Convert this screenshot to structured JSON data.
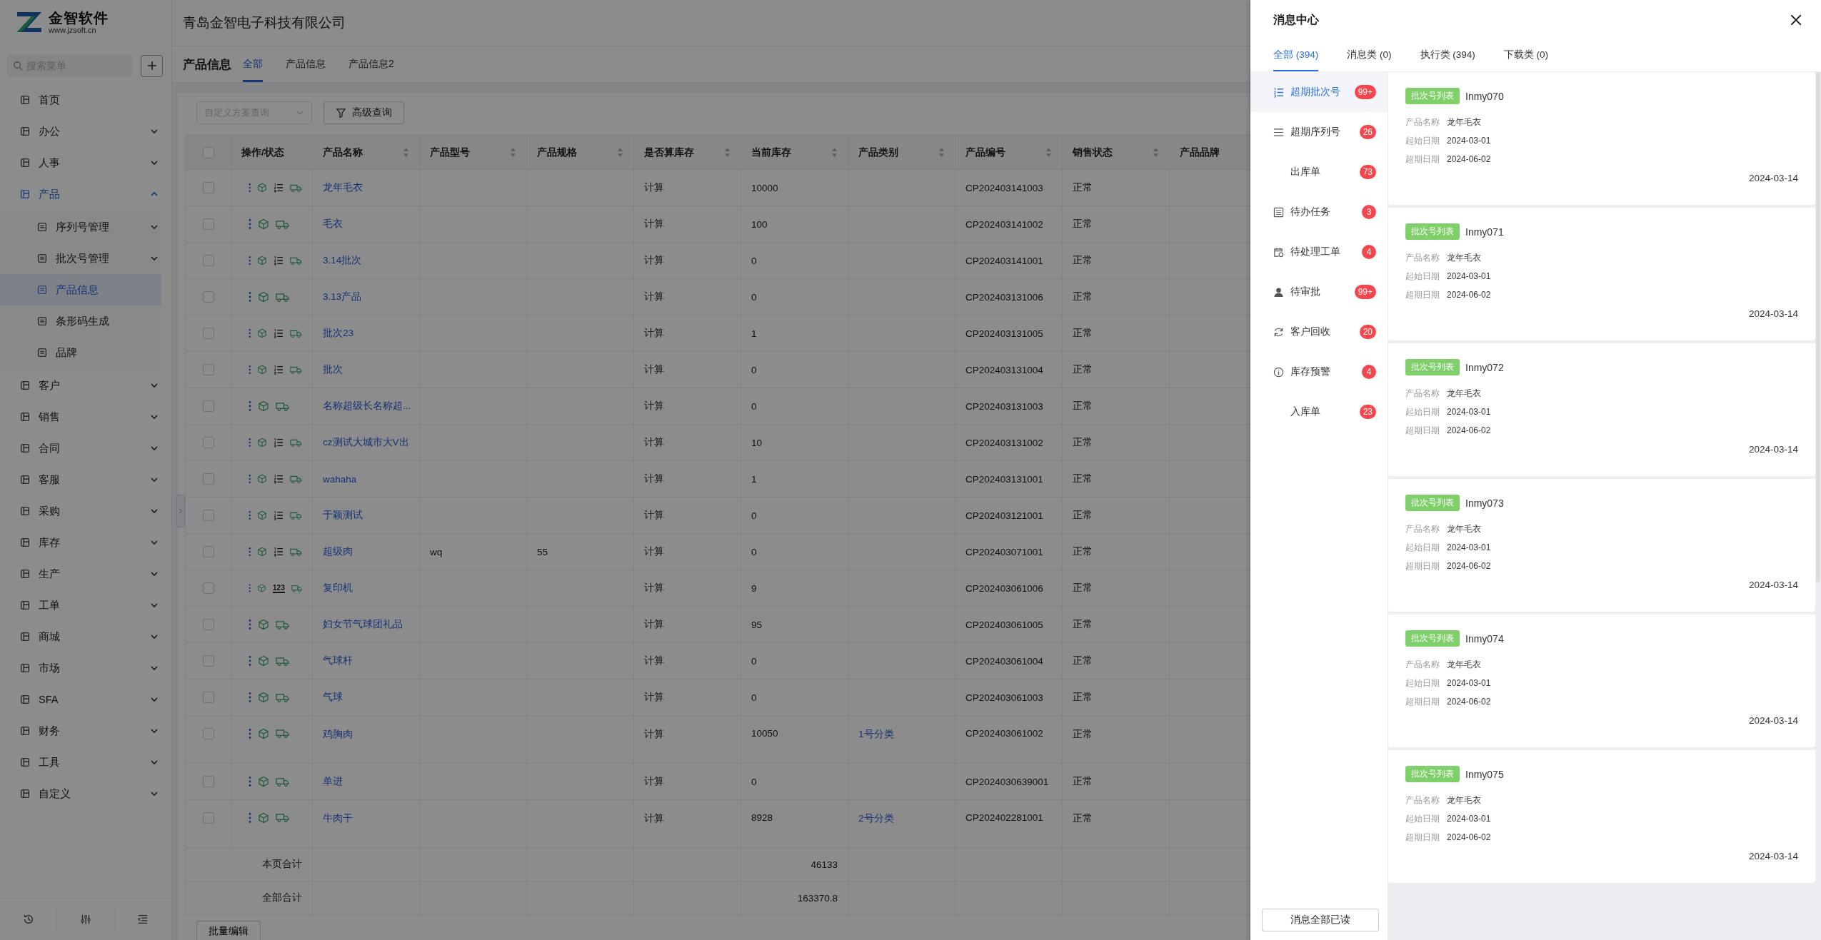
{
  "logo": {
    "name": "金智软件",
    "url": "www.jzsoft.cn"
  },
  "search": {
    "placeholder": "搜索菜单"
  },
  "sidebar": {
    "items": [
      {
        "label": "首页",
        "selected": false
      },
      {
        "label": "办公",
        "selected": false,
        "expanded": false
      },
      {
        "label": "人事",
        "selected": false,
        "expanded": false
      },
      {
        "label": "产品",
        "selected": true,
        "expanded": true,
        "children": [
          {
            "label": "序列号管理",
            "selected": false,
            "expanded": false
          },
          {
            "label": "批次号管理",
            "selected": false,
            "expanded": false
          },
          {
            "label": "产品信息",
            "selected": true
          },
          {
            "label": "条形码生成",
            "selected": false
          },
          {
            "label": "品牌",
            "selected": false
          }
        ]
      },
      {
        "label": "客户",
        "selected": false,
        "expanded": false
      },
      {
        "label": "销售",
        "selected": false,
        "expanded": false
      },
      {
        "label": "合同",
        "selected": false,
        "expanded": false
      },
      {
        "label": "客服",
        "selected": false,
        "expanded": false
      },
      {
        "label": "采购",
        "selected": false,
        "expanded": false
      },
      {
        "label": "库存",
        "selected": false,
        "expanded": false
      },
      {
        "label": "生产",
        "selected": false,
        "expanded": false
      },
      {
        "label": "工单",
        "selected": false,
        "expanded": false
      },
      {
        "label": "商城",
        "selected": false,
        "expanded": false
      },
      {
        "label": "市场",
        "selected": false,
        "expanded": false
      },
      {
        "label": "SFA",
        "selected": false,
        "expanded": false
      },
      {
        "label": "财务",
        "selected": false,
        "expanded": false
      },
      {
        "label": "工具",
        "selected": false,
        "expanded": false
      },
      {
        "label": "自定义",
        "selected": false,
        "expanded": false
      }
    ]
  },
  "company": "青岛金智电子科技有限公司",
  "page": {
    "title": "产品信息",
    "tabs": [
      {
        "label": "全部",
        "selected": true
      },
      {
        "label": "产品信息",
        "selected": false
      },
      {
        "label": "产品信息2",
        "selected": false
      }
    ]
  },
  "toolbar": {
    "scheme_select": {
      "placeholder": "自定义方案查询"
    },
    "filter_button": "高级查询"
  },
  "table": {
    "all_selected": false,
    "columns": [
      {
        "label": "操作/状态",
        "sortable": false
      },
      {
        "label": "产品名称",
        "sortable": true
      },
      {
        "label": "产品型号",
        "sortable": true
      },
      {
        "label": "产品规格",
        "sortable": true
      },
      {
        "label": "是否算库存",
        "sortable": true
      },
      {
        "label": "当前库存",
        "sortable": true
      },
      {
        "label": "产品类别",
        "sortable": true
      },
      {
        "label": "产品编号",
        "sortable": true
      },
      {
        "label": "销售状态",
        "sortable": true
      },
      {
        "label": "产品品牌"
      }
    ],
    "rows": [
      {
        "selected": false,
        "tracking": {
          "kind": "batch"
        },
        "name": "龙年毛衣",
        "stock_counted": "计算",
        "stock": "10000",
        "code": "CP202403141003",
        "sale_status": "正常"
      },
      {
        "selected": false,
        "name": "毛衣",
        "stock_counted": "计算",
        "stock": "100",
        "code": "CP202403141002",
        "sale_status": "正常"
      },
      {
        "selected": false,
        "tracking": {
          "kind": "batch"
        },
        "name": "3.14批次",
        "stock_counted": "计算",
        "stock": "0",
        "code": "CP202403141001",
        "sale_status": "正常"
      },
      {
        "selected": false,
        "name": "3.13产品",
        "stock_counted": "计算",
        "stock": "0",
        "code": "CP202403131006",
        "sale_status": "正常"
      },
      {
        "selected": false,
        "tracking": {
          "kind": "batch"
        },
        "name": "批次23",
        "stock_counted": "计算",
        "stock": "1",
        "code": "CP202403131005",
        "sale_status": "正常"
      },
      {
        "selected": false,
        "tracking": {
          "kind": "batch"
        },
        "name": "批次",
        "stock_counted": "计算",
        "stock": "0",
        "code": "CP202403131004",
        "sale_status": "正常"
      },
      {
        "selected": false,
        "name": "名称超级长名称超...",
        "stock_counted": "计算",
        "stock": "0",
        "code": "CP202403131003",
        "sale_status": "正常"
      },
      {
        "selected": false,
        "tracking": {
          "kind": "batch"
        },
        "name": "cz测试大城市大V出",
        "stock_counted": "计算",
        "stock": "10",
        "code": "CP202403131002",
        "sale_status": "正常"
      },
      {
        "selected": false,
        "tracking": {
          "kind": "batch"
        },
        "name": "wahaha",
        "stock_counted": "计算",
        "stock": "1",
        "code": "CP202403131001",
        "sale_status": "正常"
      },
      {
        "selected": false,
        "tracking": {
          "kind": "batch"
        },
        "name": "于颖测试",
        "stock_counted": "计算",
        "stock": "0",
        "code": "CP202403121001",
        "sale_status": "正常"
      },
      {
        "selected": false,
        "tracking": {
          "kind": "batch"
        },
        "name": "超级肉",
        "model": "wq",
        "spec": "55",
        "stock_counted": "计算",
        "stock": "0",
        "code": "CP202403071001",
        "sale_status": "正常"
      },
      {
        "selected": false,
        "tracking": {
          "kind": "serial",
          "label": "123"
        },
        "name": "复印机",
        "stock_counted": "计算",
        "stock": "9",
        "code": "CP202403061006",
        "sale_status": "正常"
      },
      {
        "selected": false,
        "name": "妇女节气球团礼品",
        "stock_counted": "计算",
        "stock": "95",
        "code": "CP202403061005",
        "sale_status": "正常"
      },
      {
        "selected": false,
        "name": "气球杆",
        "stock_counted": "计算",
        "stock": "0",
        "code": "CP202403061004",
        "sale_status": "正常"
      },
      {
        "selected": false,
        "name": "气球",
        "stock_counted": "计算",
        "stock": "0",
        "code": "CP202403061003",
        "sale_status": "正常"
      },
      {
        "selected": false,
        "name": "鸡胸肉",
        "stock_counted": "计算",
        "stock": "10050",
        "category": "1号分类",
        "code": "CP202403061002",
        "sale_status": "正常"
      },
      {
        "selected": false,
        "name": "单进",
        "stock_counted": "计算",
        "stock": "0",
        "code": "CP2024030639001",
        "sale_status": "正常"
      },
      {
        "selected": false,
        "name": "牛肉干",
        "stock_counted": "计算",
        "stock": "8928",
        "category": "2号分类",
        "code": "CP202402281001",
        "sale_status": "正常"
      }
    ],
    "totals": [
      {
        "label": "本页合计",
        "stock": "46133"
      },
      {
        "label": "全部合计",
        "stock": "163370.8"
      }
    ]
  },
  "batch_edit_button": "批量编辑",
  "message_center": {
    "title": "消息中心",
    "tabs": [
      {
        "label": "全部 (394)",
        "selected": true
      },
      {
        "label": "消息类 (0)",
        "selected": false
      },
      {
        "label": "执行类 (394)",
        "selected": false
      },
      {
        "label": "下载类 (0)",
        "selected": false
      }
    ],
    "categories": [
      {
        "label": "超期批次号",
        "count": "99+",
        "selected": true
      },
      {
        "label": "超期序列号",
        "count": "26",
        "selected": false
      },
      {
        "label": "出库单",
        "count": "73",
        "selected": false
      },
      {
        "label": "待办任务",
        "count": "3",
        "selected": false
      },
      {
        "label": "待处理工单",
        "count": "4",
        "selected": false
      },
      {
        "label": "待审批",
        "count": "99+",
        "selected": false
      },
      {
        "label": "客户回收",
        "count": "20",
        "selected": false
      },
      {
        "label": "库存预警",
        "count": "4",
        "selected": false
      },
      {
        "label": "入库单",
        "count": "23",
        "selected": false
      }
    ],
    "messages": [
      {
        "tag": "批次号列表",
        "title": "Inmy070",
        "fields": [
          {
            "label": "产品名称",
            "value": "龙年毛衣"
          },
          {
            "label": "起始日期",
            "value": "2024-03-01"
          },
          {
            "label": "超期日期",
            "value": "2024-06-02"
          }
        ],
        "date": "2024-03-14"
      },
      {
        "tag": "批次号列表",
        "title": "Inmy071",
        "fields": [
          {
            "label": "产品名称",
            "value": "龙年毛衣"
          },
          {
            "label": "起始日期",
            "value": "2024-03-01"
          },
          {
            "label": "超期日期",
            "value": "2024-06-02"
          }
        ],
        "date": "2024-03-14"
      },
      {
        "tag": "批次号列表",
        "title": "Inmy072",
        "fields": [
          {
            "label": "产品名称",
            "value": "龙年毛衣"
          },
          {
            "label": "起始日期",
            "value": "2024-03-01"
          },
          {
            "label": "超期日期",
            "value": "2024-06-02"
          }
        ],
        "date": "2024-03-14"
      },
      {
        "tag": "批次号列表",
        "title": "Inmy073",
        "fields": [
          {
            "label": "产品名称",
            "value": "龙年毛衣"
          },
          {
            "label": "起始日期",
            "value": "2024-03-01"
          },
          {
            "label": "超期日期",
            "value": "2024-06-02"
          }
        ],
        "date": "2024-03-14"
      },
      {
        "tag": "批次号列表",
        "title": "Inmy074",
        "fields": [
          {
            "label": "产品名称",
            "value": "龙年毛衣"
          },
          {
            "label": "起始日期",
            "value": "2024-03-01"
          },
          {
            "label": "超期日期",
            "value": "2024-06-02"
          }
        ],
        "date": "2024-03-14"
      },
      {
        "tag": "批次号列表",
        "title": "Inmy075",
        "fields": [
          {
            "label": "产品名称",
            "value": "龙年毛衣"
          },
          {
            "label": "起始日期",
            "value": "2024-03-01"
          },
          {
            "label": "超期日期",
            "value": "2024-06-02"
          }
        ],
        "date": "2024-03-14"
      }
    ],
    "mark_all_read_button": "消息全部已读"
  }
}
